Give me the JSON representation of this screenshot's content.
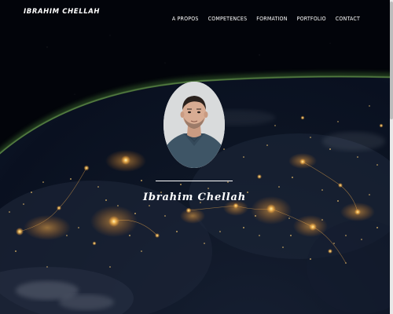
{
  "brand": {
    "name": "IBRAHIM CHELLAH"
  },
  "nav": {
    "items": [
      {
        "label": "A PROPOS"
      },
      {
        "label": "COMPETENCES"
      },
      {
        "label": "FORMATION"
      },
      {
        "label": "PORTFOLIO"
      },
      {
        "label": "CONTACT"
      }
    ]
  },
  "hero": {
    "name": "Ibrahim Chellah",
    "background": "earth-at-night-from-space-image",
    "avatar": "profile-photo"
  },
  "colors": {
    "text": "#ffffff",
    "space": "#02040a",
    "atmosphere": "#6fa64a",
    "city_lights": "#ffc25a"
  }
}
